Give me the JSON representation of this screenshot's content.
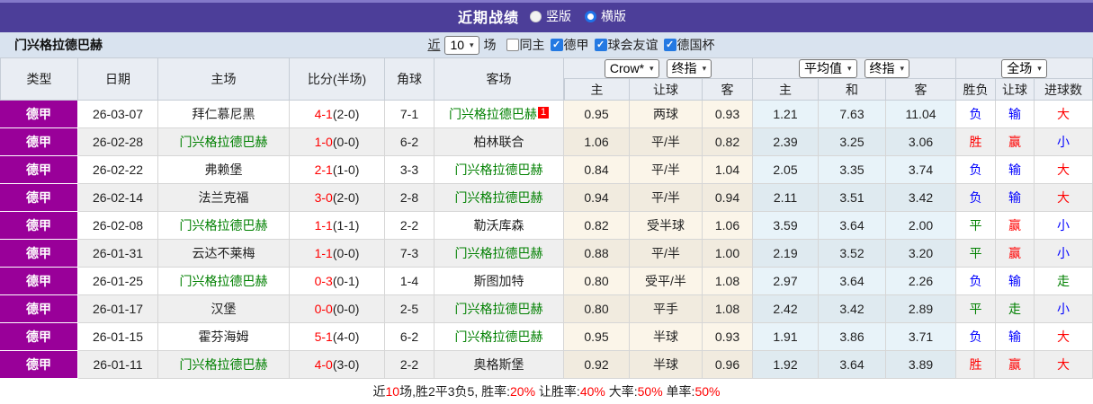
{
  "title_bar": {
    "title": "近期战绩",
    "radio_vertical": "竖版",
    "radio_horizontal": "横版",
    "vertical_selected": false,
    "horizontal_selected": true
  },
  "filter_bar": {
    "team_name": "门兴格拉德巴赫",
    "recent_label": "近",
    "count_value": "10",
    "games_label": "场",
    "checkboxes": [
      {
        "label": "同主",
        "checked": false
      },
      {
        "label": "德甲",
        "checked": true
      },
      {
        "label": "球会友谊",
        "checked": true
      },
      {
        "label": "德国杯",
        "checked": true
      }
    ]
  },
  "table": {
    "static_headers": [
      "类型",
      "日期",
      "主场",
      "比分(半场)",
      "角球",
      "客场"
    ],
    "selects": {
      "crow": "Crow*",
      "crow_final": "终指",
      "avg": "平均值",
      "avg_final": "终指",
      "full_match": "全场"
    },
    "sub_headers": [
      "主",
      "让球",
      "客",
      "主",
      "和",
      "客",
      "胜负",
      "让球",
      "进球数"
    ],
    "rows": [
      {
        "type": "德甲",
        "date": "26-03-07",
        "home": "拜仁慕尼黑",
        "home_green": false,
        "score": "4-1",
        "half": "(2-0)",
        "corner": "7-1",
        "away": "门兴格拉德巴赫",
        "away_green": true,
        "badge": "1",
        "odds": [
          "0.95",
          "两球",
          "0.93"
        ],
        "avg": [
          "1.21",
          "7.63",
          "11.04"
        ],
        "results": [
          {
            "text": "负",
            "color": "blue"
          },
          {
            "text": "输",
            "color": "blue"
          },
          {
            "text": "大",
            "color": "red"
          }
        ]
      },
      {
        "type": "德甲",
        "date": "26-02-28",
        "home": "门兴格拉德巴赫",
        "home_green": true,
        "score": "1-0",
        "half": "(0-0)",
        "corner": "6-2",
        "away": "柏林联合",
        "away_green": false,
        "badge": "",
        "odds": [
          "1.06",
          "平/半",
          "0.82"
        ],
        "avg": [
          "2.39",
          "3.25",
          "3.06"
        ],
        "results": [
          {
            "text": "胜",
            "color": "red"
          },
          {
            "text": "赢",
            "color": "red"
          },
          {
            "text": "小",
            "color": "blue"
          }
        ]
      },
      {
        "type": "德甲",
        "date": "26-02-22",
        "home": "弗赖堡",
        "home_green": false,
        "score": "2-1",
        "half": "(1-0)",
        "corner": "3-3",
        "away": "门兴格拉德巴赫",
        "away_green": true,
        "badge": "",
        "odds": [
          "0.84",
          "平/半",
          "1.04"
        ],
        "avg": [
          "2.05",
          "3.35",
          "3.74"
        ],
        "results": [
          {
            "text": "负",
            "color": "blue"
          },
          {
            "text": "输",
            "color": "blue"
          },
          {
            "text": "大",
            "color": "red"
          }
        ]
      },
      {
        "type": "德甲",
        "date": "26-02-14",
        "home": "法兰克福",
        "home_green": false,
        "score": "3-0",
        "half": "(2-0)",
        "corner": "2-8",
        "away": "门兴格拉德巴赫",
        "away_green": true,
        "badge": "",
        "odds": [
          "0.94",
          "平/半",
          "0.94"
        ],
        "avg": [
          "2.11",
          "3.51",
          "3.42"
        ],
        "results": [
          {
            "text": "负",
            "color": "blue"
          },
          {
            "text": "输",
            "color": "blue"
          },
          {
            "text": "大",
            "color": "red"
          }
        ]
      },
      {
        "type": "德甲",
        "date": "26-02-08",
        "home": "门兴格拉德巴赫",
        "home_green": true,
        "score": "1-1",
        "half": "(1-1)",
        "corner": "2-2",
        "away": "勒沃库森",
        "away_green": false,
        "badge": "",
        "odds": [
          "0.82",
          "受半球",
          "1.06"
        ],
        "avg": [
          "3.59",
          "3.64",
          "2.00"
        ],
        "results": [
          {
            "text": "平",
            "color": "green"
          },
          {
            "text": "赢",
            "color": "red"
          },
          {
            "text": "小",
            "color": "blue"
          }
        ]
      },
      {
        "type": "德甲",
        "date": "26-01-31",
        "home": "云达不莱梅",
        "home_green": false,
        "score": "1-1",
        "half": "(0-0)",
        "corner": "7-3",
        "away": "门兴格拉德巴赫",
        "away_green": true,
        "badge": "",
        "odds": [
          "0.88",
          "平/半",
          "1.00"
        ],
        "avg": [
          "2.19",
          "3.52",
          "3.20"
        ],
        "results": [
          {
            "text": "平",
            "color": "green"
          },
          {
            "text": "赢",
            "color": "red"
          },
          {
            "text": "小",
            "color": "blue"
          }
        ]
      },
      {
        "type": "德甲",
        "date": "26-01-25",
        "home": "门兴格拉德巴赫",
        "home_green": true,
        "score": "0-3",
        "half": "(0-1)",
        "corner": "1-4",
        "away": "斯图加特",
        "away_green": false,
        "badge": "",
        "odds": [
          "0.80",
          "受平/半",
          "1.08"
        ],
        "avg": [
          "2.97",
          "3.64",
          "2.26"
        ],
        "results": [
          {
            "text": "负",
            "color": "blue"
          },
          {
            "text": "输",
            "color": "blue"
          },
          {
            "text": "走",
            "color": "green"
          }
        ]
      },
      {
        "type": "德甲",
        "date": "26-01-17",
        "home": "汉堡",
        "home_green": false,
        "score": "0-0",
        "half": "(0-0)",
        "corner": "2-5",
        "away": "门兴格拉德巴赫",
        "away_green": true,
        "badge": "",
        "odds": [
          "0.80",
          "平手",
          "1.08"
        ],
        "avg": [
          "2.42",
          "3.42",
          "2.89"
        ],
        "results": [
          {
            "text": "平",
            "color": "green"
          },
          {
            "text": "走",
            "color": "green"
          },
          {
            "text": "小",
            "color": "blue"
          }
        ]
      },
      {
        "type": "德甲",
        "date": "26-01-15",
        "home": "霍芬海姆",
        "home_green": false,
        "score": "5-1",
        "half": "(4-0)",
        "corner": "6-2",
        "away": "门兴格拉德巴赫",
        "away_green": true,
        "badge": "",
        "odds": [
          "0.95",
          "半球",
          "0.93"
        ],
        "avg": [
          "1.91",
          "3.86",
          "3.71"
        ],
        "results": [
          {
            "text": "负",
            "color": "blue"
          },
          {
            "text": "输",
            "color": "blue"
          },
          {
            "text": "大",
            "color": "red"
          }
        ]
      },
      {
        "type": "德甲",
        "date": "26-01-11",
        "home": "门兴格拉德巴赫",
        "home_green": true,
        "score": "4-0",
        "half": "(3-0)",
        "corner": "2-2",
        "away": "奥格斯堡",
        "away_green": false,
        "badge": "",
        "odds": [
          "0.92",
          "半球",
          "0.96"
        ],
        "avg": [
          "1.92",
          "3.64",
          "3.89"
        ],
        "results": [
          {
            "text": "胜",
            "color": "red"
          },
          {
            "text": "赢",
            "color": "red"
          },
          {
            "text": "大",
            "color": "red"
          }
        ]
      }
    ]
  },
  "footer": {
    "parts": [
      {
        "text": "近",
        "red": false
      },
      {
        "text": "10",
        "red": true
      },
      {
        "text": "场,胜2平3负5, 胜率:",
        "red": false
      },
      {
        "text": "20%",
        "red": true
      },
      {
        "text": " 让胜率:",
        "red": false
      },
      {
        "text": "40%",
        "red": true
      },
      {
        "text": " 大率:",
        "red": false
      },
      {
        "text": "50%",
        "red": true
      },
      {
        "text": " 单率:",
        "red": false
      },
      {
        "text": "50%",
        "red": true
      }
    ]
  },
  "colors": {
    "topbar": "#4c3e99",
    "filterbar": "#d9e3ef",
    "league_badge": "#990099",
    "team_highlight": "#008000",
    "win_red": "#ff0000",
    "loss_blue": "#0000ff",
    "draw_green": "#008000",
    "odds_bg": "#fbf5e9",
    "avg_bg": "#e8f3f9"
  }
}
